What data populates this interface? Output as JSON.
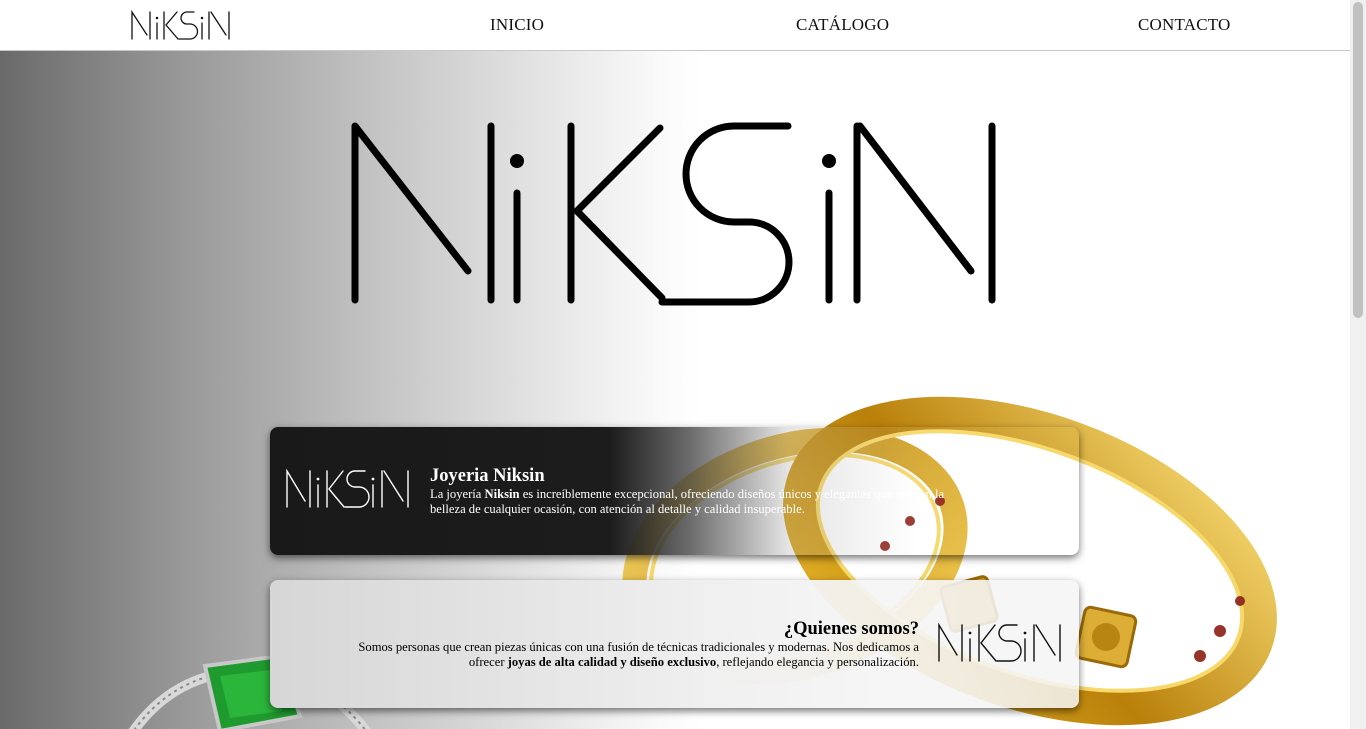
{
  "nav": {
    "brand_name": "NiKSiN",
    "links": [
      "INICIO",
      "CATÁLOGO",
      "CONTACTO"
    ]
  },
  "hero": {
    "logo_text": "NiKSiN"
  },
  "cards": [
    {
      "logo_text": "NiKSiN",
      "title": "Joyeria Niksin",
      "body_pre": "La joyería ",
      "body_bold": "Niksin",
      "body_post": " es increíblemente excepcional, ofreciendo diseños únicos y elegantes que realzan la belleza de cualquier ocasión, con atención al detalle y calidad insuperable."
    },
    {
      "logo_text": "NiKSiN",
      "title": "¿Quienes somos?",
      "body_pre": "Somos personas que crean piezas únicas con una fusión de técnicas tradicionales y modernas. Nos dedicamos a ofrecer ",
      "body_bold": "joyas de alta calidad y diseño exclusivo",
      "body_post": ", reflejando elegancia y personalización."
    }
  ],
  "colors": {
    "dark_card": "#1c1c1c",
    "light_card": "#e8e8e8",
    "gold": "#d8a81c",
    "emerald": "#1e9a2e"
  },
  "icons": [
    "niksin-logo-icon",
    "bracelets-image",
    "emerald-ring-image"
  ]
}
